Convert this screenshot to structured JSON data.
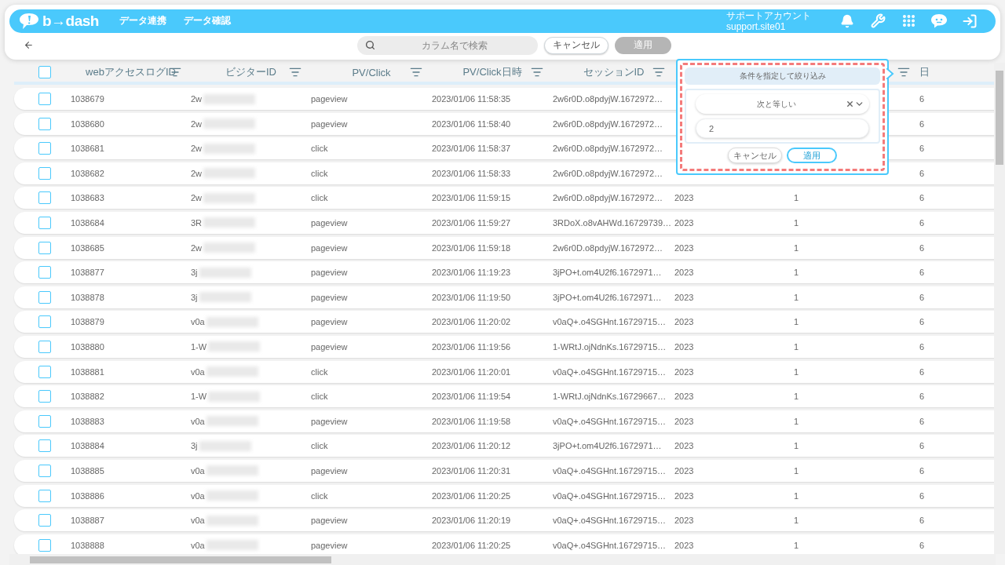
{
  "header": {
    "brand": "b→dash",
    "nav": [
      {
        "label": "データ連携"
      },
      {
        "label": "データ確認"
      }
    ],
    "account": {
      "name": "サポートアカウント",
      "id": "support.site01"
    }
  },
  "toolbar": {
    "search": {
      "placeholder": "カラム名で検索"
    },
    "cancel": "キャンセル",
    "apply": {
      "label": "適用",
      "disabled": true
    }
  },
  "table": {
    "select_all": {
      "checked": false
    },
    "columns": [
      {
        "label": "webアクセスログID",
        "filter": true
      },
      {
        "label": "ビジターID",
        "filter": true,
        "redacted": true
      },
      {
        "label": "PV/Click",
        "filter": true
      },
      {
        "label": "PV/Click日時",
        "filter": true
      },
      {
        "label": "セッションID",
        "filter": true
      },
      {},
      {
        "filter": true
      },
      {
        "label": "日"
      }
    ],
    "rows": [
      {
        "checked": false,
        "cells": [
          "1038679",
          "2w",
          "pageview",
          "2023/01/06 11:58:35",
          "2w6r0D.o8pdyjW.1672972…",
          null,
          null,
          "6"
        ]
      },
      {
        "checked": false,
        "cells": [
          "1038680",
          "2w",
          "pageview",
          "2023/01/06 11:58:40",
          "2w6r0D.o8pdyjW.1672972…",
          null,
          null,
          "6"
        ]
      },
      {
        "checked": false,
        "cells": [
          "1038681",
          "2w",
          "click",
          "2023/01/06 11:58:37",
          "2w6r0D.o8pdyjW.1672972…",
          null,
          null,
          "6"
        ]
      },
      {
        "checked": false,
        "cells": [
          "1038682",
          "2w",
          "click",
          "2023/01/06 11:58:33",
          "2w6r0D.o8pdyjW.1672972…",
          null,
          null,
          "6"
        ]
      },
      {
        "checked": false,
        "cells": [
          "1038683",
          "2w",
          "click",
          "2023/01/06 11:59:15",
          "2w6r0D.o8pdyjW.1672972…",
          "2023",
          "1",
          "6"
        ]
      },
      {
        "checked": false,
        "cells": [
          "1038684",
          "3R",
          "pageview",
          "2023/01/06 11:59:27",
          "3RDoX.o8vAHWd.16729739…",
          "2023",
          "1",
          "6"
        ]
      },
      {
        "checked": false,
        "cells": [
          "1038685",
          "2w",
          "pageview",
          "2023/01/06 11:59:18",
          "2w6r0D.o8pdyjW.1672972…",
          "2023",
          "1",
          "6"
        ]
      },
      {
        "checked": false,
        "cells": [
          "1038877",
          "3j",
          "pageview",
          "2023/01/06 11:19:23",
          "3jPO+t.om4U2f6.1672971…",
          "2023",
          "1",
          "6"
        ]
      },
      {
        "checked": false,
        "cells": [
          "1038878",
          "3j",
          "pageview",
          "2023/01/06 11:19:50",
          "3jPO+t.om4U2f6.1672971…",
          "2023",
          "1",
          "6"
        ]
      },
      {
        "checked": false,
        "cells": [
          "1038879",
          "v0a",
          "pageview",
          "2023/01/06 11:20:02",
          "v0aQ+.o4SGHnt.16729715…",
          "2023",
          "1",
          "6"
        ]
      },
      {
        "checked": false,
        "cells": [
          "1038880",
          "1-W",
          "pageview",
          "2023/01/06 11:19:56",
          "1-WRtJ.ojNdnKs.16729715…",
          "2023",
          "1",
          "6"
        ]
      },
      {
        "checked": false,
        "cells": [
          "1038881",
          "v0a",
          "click",
          "2023/01/06 11:20:01",
          "v0aQ+.o4SGHnt.16729715…",
          "2023",
          "1",
          "6"
        ]
      },
      {
        "checked": false,
        "cells": [
          "1038882",
          "1-W",
          "click",
          "2023/01/06 11:19:54",
          "1-WRtJ.ojNdnKs.16729667…",
          "2023",
          "1",
          "6"
        ]
      },
      {
        "checked": false,
        "cells": [
          "1038883",
          "v0a",
          "pageview",
          "2023/01/06 11:19:58",
          "v0aQ+.o4SGHnt.16729715…",
          "2023",
          "1",
          "6"
        ]
      },
      {
        "checked": false,
        "cells": [
          "1038884",
          "3j",
          "click",
          "2023/01/06 11:20:12",
          "3jPO+t.om4U2f6.1672971…",
          "2023",
          "1",
          "6"
        ]
      },
      {
        "checked": false,
        "cells": [
          "1038885",
          "v0a",
          "pageview",
          "2023/01/06 11:20:31",
          "v0aQ+.o4SGHnt.16729715…",
          "2023",
          "1",
          "6"
        ]
      },
      {
        "checked": false,
        "cells": [
          "1038886",
          "v0a",
          "click",
          "2023/01/06 11:20:25",
          "v0aQ+.o4SGHnt.16729715…",
          "2023",
          "1",
          "6"
        ]
      },
      {
        "checked": false,
        "cells": [
          "1038887",
          "v0a",
          "pageview",
          "2023/01/06 11:20:19",
          "v0aQ+.o4SGHnt.16729715…",
          "2023",
          "1",
          "6"
        ]
      },
      {
        "checked": false,
        "cells": [
          "1038888",
          "v0a",
          "pageview",
          "2023/01/06 11:20:25",
          "v0aQ+.o4SGHnt.16729715…",
          "2023",
          "1",
          "6"
        ]
      }
    ]
  },
  "filter_popup": {
    "title": "条件を指定して絞り込み",
    "operator": "次と等しい",
    "value": "2",
    "cancel": "キャンセル",
    "apply": "適用"
  }
}
